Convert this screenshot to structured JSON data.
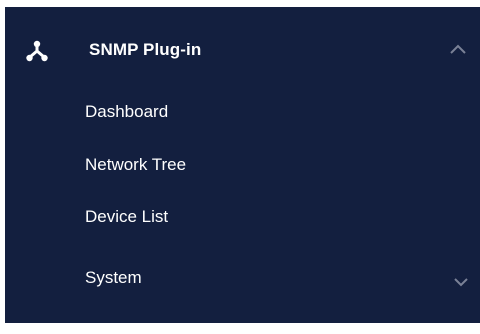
{
  "menu": {
    "header": {
      "label": "SNMP Plug-in",
      "icon": "network-hub-icon",
      "expanded_icon": "chevron-up-icon"
    },
    "items": [
      {
        "label": "Dashboard"
      },
      {
        "label": "Network Tree"
      },
      {
        "label": "Device List"
      }
    ],
    "system": {
      "label": "System",
      "icon": "chevron-down-icon"
    }
  },
  "colors": {
    "panel_background": "#131f3f",
    "text": "#ffffff",
    "chevron": "#7a8196"
  }
}
